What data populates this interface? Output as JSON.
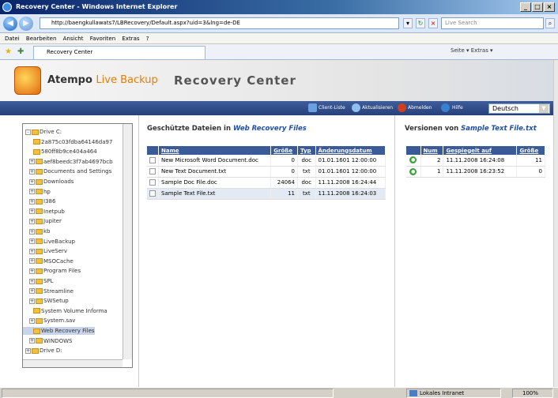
{
  "window": {
    "title": "Recovery Center - Windows Internet Explorer"
  },
  "address": {
    "url": "http://baengkullawats7/LBRecovery/Default.aspx?uid=3&lng=de-DE",
    "search_placeholder": "Live Search"
  },
  "menu": [
    "Datei",
    "Bearbeiten",
    "Ansicht",
    "Favoriten",
    "Extras",
    "?"
  ],
  "tab": {
    "label": "Recovery Center",
    "right_tools": "Seite ▾  Extras ▾"
  },
  "app": {
    "brand_main": "Atempo",
    "brand_live": "Live Backup",
    "title": "Recovery Center"
  },
  "toolbar": {
    "client_list": "Client-Liste",
    "refresh": "Aktualisieren",
    "logout": "Abmelden",
    "help": "Hilfe",
    "language": "Deutsch"
  },
  "tree": [
    {
      "label": "Drive C:",
      "level": 0,
      "exp": "-"
    },
    {
      "label": "2a875c03fdba64146da97",
      "level": 2,
      "exp": ""
    },
    {
      "label": "580ff8b9ce404a464",
      "level": 2,
      "exp": ""
    },
    {
      "label": "aef8beedc3f7ab4697bcb",
      "level": 1,
      "exp": "+"
    },
    {
      "label": "Documents and Settings",
      "level": 1,
      "exp": "+"
    },
    {
      "label": "Downloads",
      "level": 1,
      "exp": "+"
    },
    {
      "label": "hp",
      "level": 1,
      "exp": "+"
    },
    {
      "label": "I386",
      "level": 1,
      "exp": "+"
    },
    {
      "label": "Inetpub",
      "level": 1,
      "exp": "+"
    },
    {
      "label": "Jupiter",
      "level": 1,
      "exp": "+"
    },
    {
      "label": "kb",
      "level": 1,
      "exp": "+"
    },
    {
      "label": "LiveBackup",
      "level": 1,
      "exp": "+"
    },
    {
      "label": "LiveServ",
      "level": 1,
      "exp": "+"
    },
    {
      "label": "MSOCache",
      "level": 1,
      "exp": "+"
    },
    {
      "label": "Program Files",
      "level": 1,
      "exp": "+"
    },
    {
      "label": "SPL",
      "level": 1,
      "exp": "+"
    },
    {
      "label": "Streamline",
      "level": 1,
      "exp": "+"
    },
    {
      "label": "SWSetup",
      "level": 1,
      "exp": "+"
    },
    {
      "label": "System Volume Informa",
      "level": 2,
      "exp": ""
    },
    {
      "label": "System.sav",
      "level": 1,
      "exp": "+"
    },
    {
      "label": "Web Recovery Files",
      "level": 2,
      "exp": "",
      "selected": true
    },
    {
      "label": "WINDOWS",
      "level": 1,
      "exp": "+"
    },
    {
      "label": "Drive D:",
      "level": 0,
      "exp": "+"
    }
  ],
  "files": {
    "title_prefix": "Geschützte Dateien in",
    "folder": "Web Recovery Files",
    "headers": [
      "Name",
      "Größe",
      "Typ",
      "Änderungsdatum"
    ],
    "rows": [
      {
        "name": "New Microsoft Word Document.doc",
        "size": "0",
        "type": "doc",
        "date": "01.01.1601 12:00:00"
      },
      {
        "name": "New Text Document.txt",
        "size": "0",
        "type": "txt",
        "date": "01.01.1601 12:00:00"
      },
      {
        "name": "Sample Doc File.doc",
        "size": "24064",
        "type": "doc",
        "date": "11.11.2008 16:24:44"
      },
      {
        "name": "Sample Text File.txt",
        "size": "11",
        "type": "txt",
        "date": "11.11.2008 16:24:03",
        "highlight": true
      }
    ]
  },
  "versions": {
    "title_prefix": "Versionen von",
    "file": "Sample Text File.txt",
    "headers": [
      "",
      "Num",
      "Gespiegelt auf",
      "Größe"
    ],
    "rows": [
      {
        "num": "2",
        "date": "11.11.2008 16:24:08",
        "size": "11"
      },
      {
        "num": "1",
        "date": "11.11.2008 16:23:52",
        "size": "0"
      }
    ]
  },
  "status": {
    "zone": "Lokales Intranet",
    "zoom": "100%"
  }
}
